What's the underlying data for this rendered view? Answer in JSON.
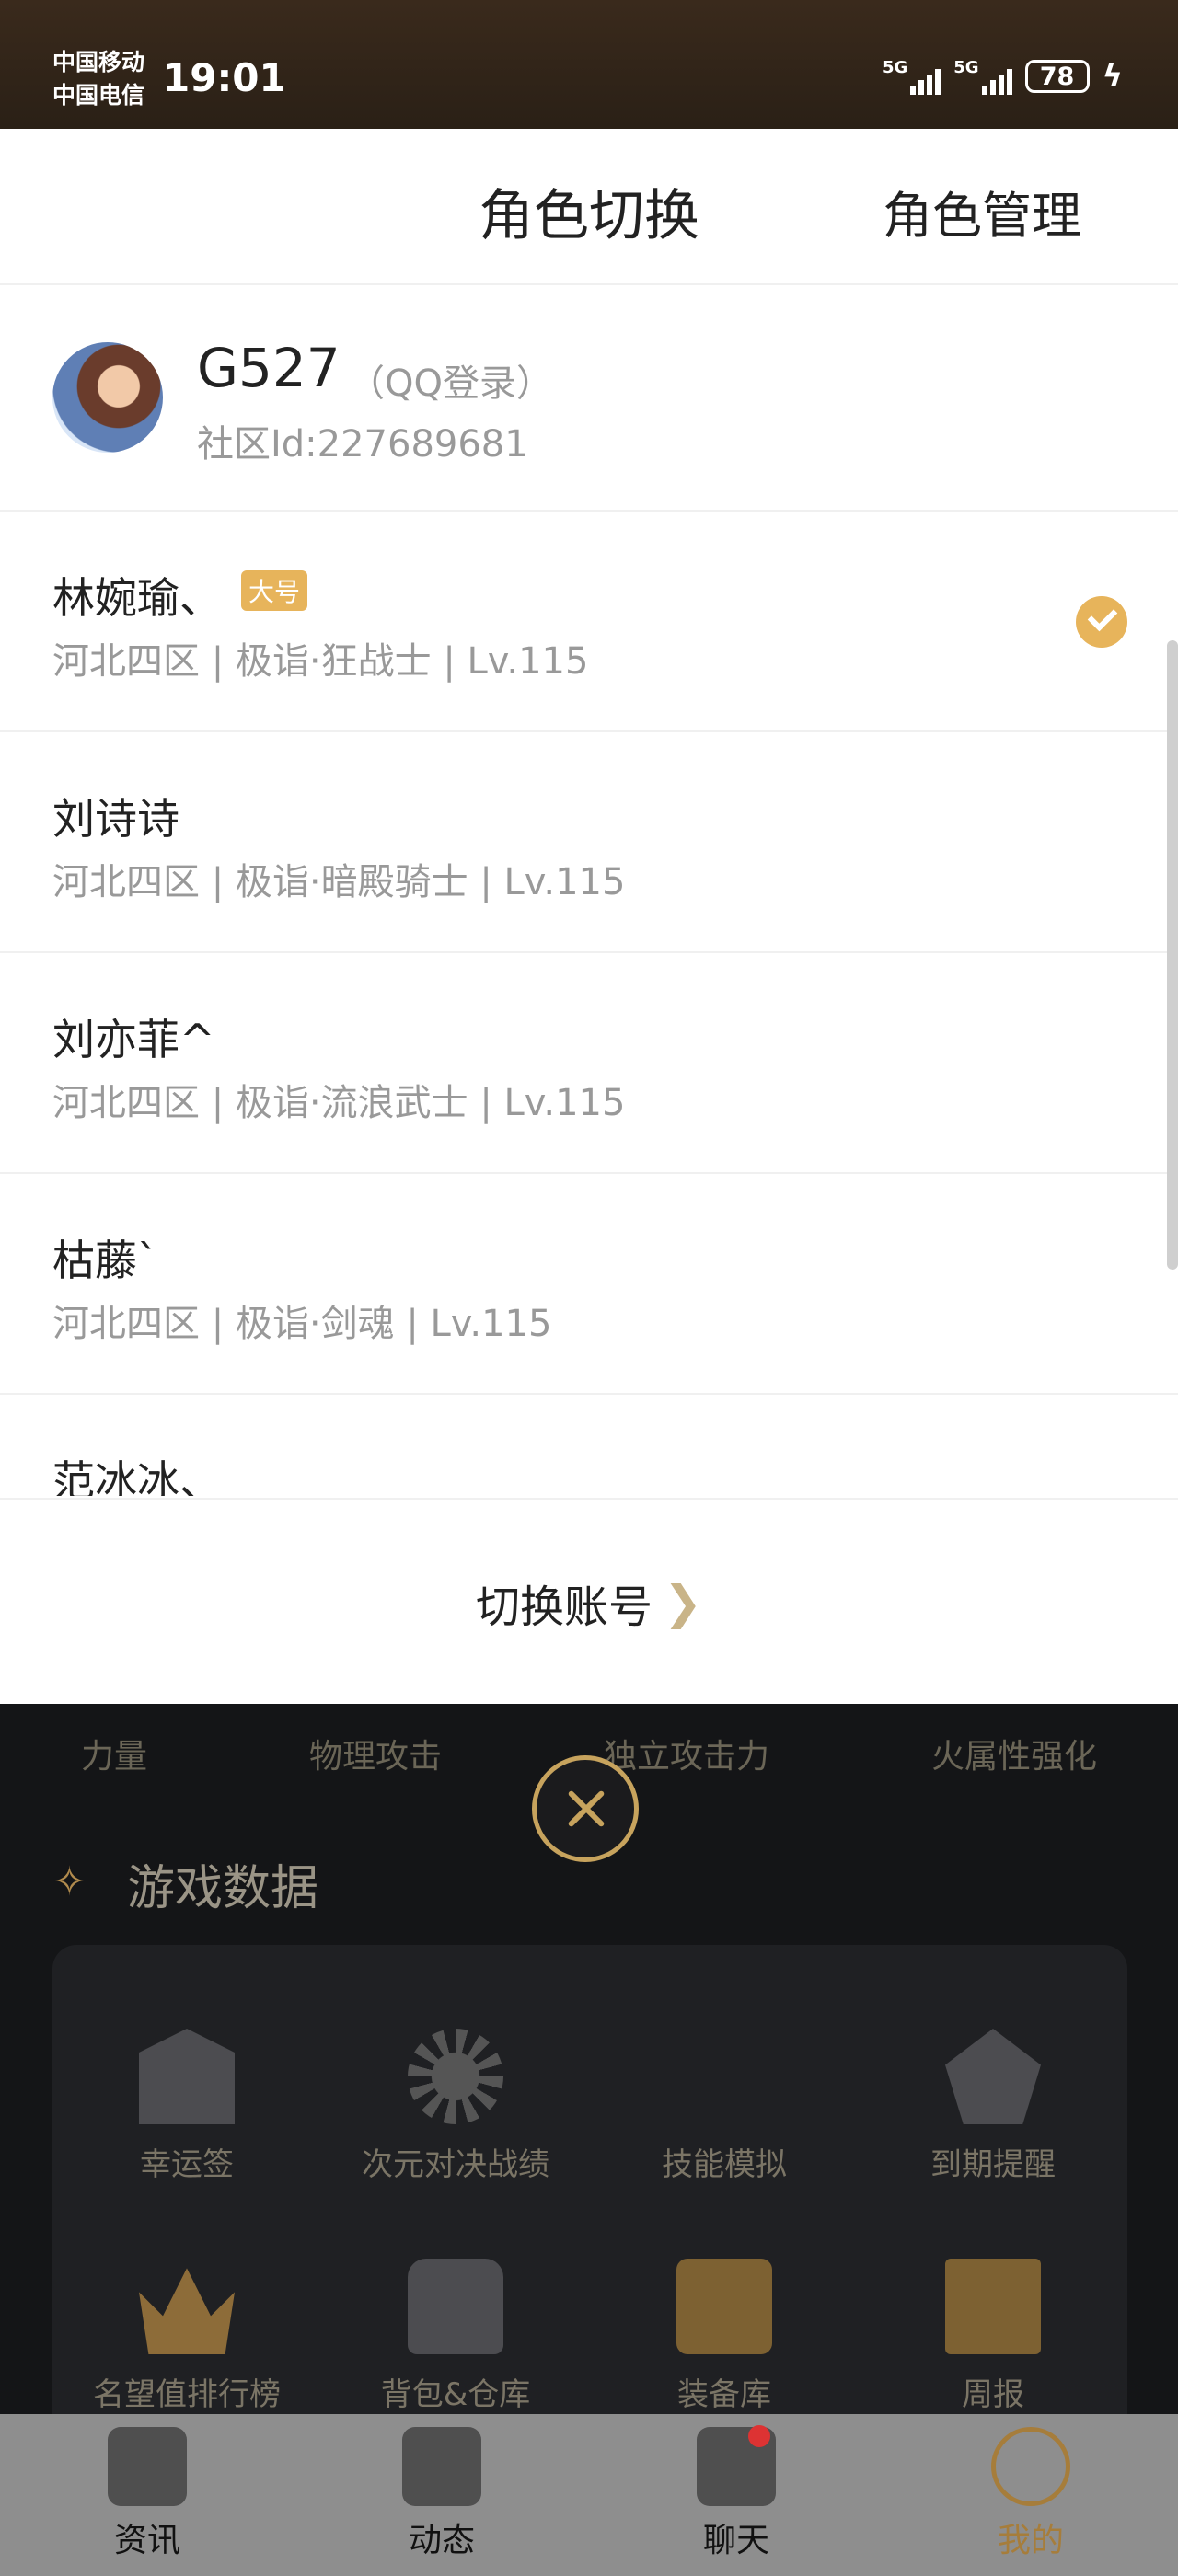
{
  "status_bar": {
    "carrier1": "中国移动",
    "carrier2": "中国电信",
    "time": "19:01",
    "signal1": "5G",
    "signal2": "5G",
    "battery": "78"
  },
  "sheet": {
    "title": "角色切换",
    "manage_label": "角色管理"
  },
  "account": {
    "name": "G527",
    "login_type": "（QQ登录）",
    "community_id": "社区Id:227689681"
  },
  "roles": [
    {
      "name": "林婉瑜、",
      "badge": "大号",
      "info": "河北四区 | 极诣·狂战士 | Lv.115",
      "selected": true
    },
    {
      "name": "刘诗诗",
      "info": "河北四区 | 极诣·暗殿骑士 | Lv.115"
    },
    {
      "name": "刘亦菲^",
      "info": "河北四区 | 极诣·流浪武士 | Lv.115"
    },
    {
      "name": "枯藤`",
      "info": "河北四区 | 极诣·剑魂 | Lv.115"
    },
    {
      "name": "范冰冰、",
      "info": ""
    }
  ],
  "switch_account": {
    "label": "切换账号",
    "chevron": "❯"
  },
  "background": {
    "attrs": [
      "力量",
      "物理攻击",
      "独立攻击力",
      "火属性强化"
    ],
    "section_icon": "✧",
    "section_title": "游戏数据",
    "tiles": [
      {
        "label": "幸运签",
        "icon": "lucky-sign-icon"
      },
      {
        "label": "次元对决战绩",
        "icon": "battle-record-icon"
      },
      {
        "label": "技能模拟",
        "icon": "skill-sim-icon"
      },
      {
        "label": "到期提醒",
        "icon": "bell-icon"
      },
      {
        "label": "名望值排行榜",
        "icon": "crown-icon"
      },
      {
        "label": "背包&仓库",
        "icon": "bag-icon"
      },
      {
        "label": "装备库",
        "icon": "chest-icon"
      },
      {
        "label": "周报",
        "icon": "scroll-icon"
      }
    ]
  },
  "tabbar": [
    {
      "label": "资讯",
      "icon": "news-icon"
    },
    {
      "label": "动态",
      "icon": "dynamics-icon"
    },
    {
      "label": "聊天",
      "icon": "chat-icon"
    },
    {
      "label": "我的",
      "icon": "profile-icon"
    }
  ],
  "colors": {
    "accent": "#e7b45b",
    "gold": "#c7a35d"
  }
}
